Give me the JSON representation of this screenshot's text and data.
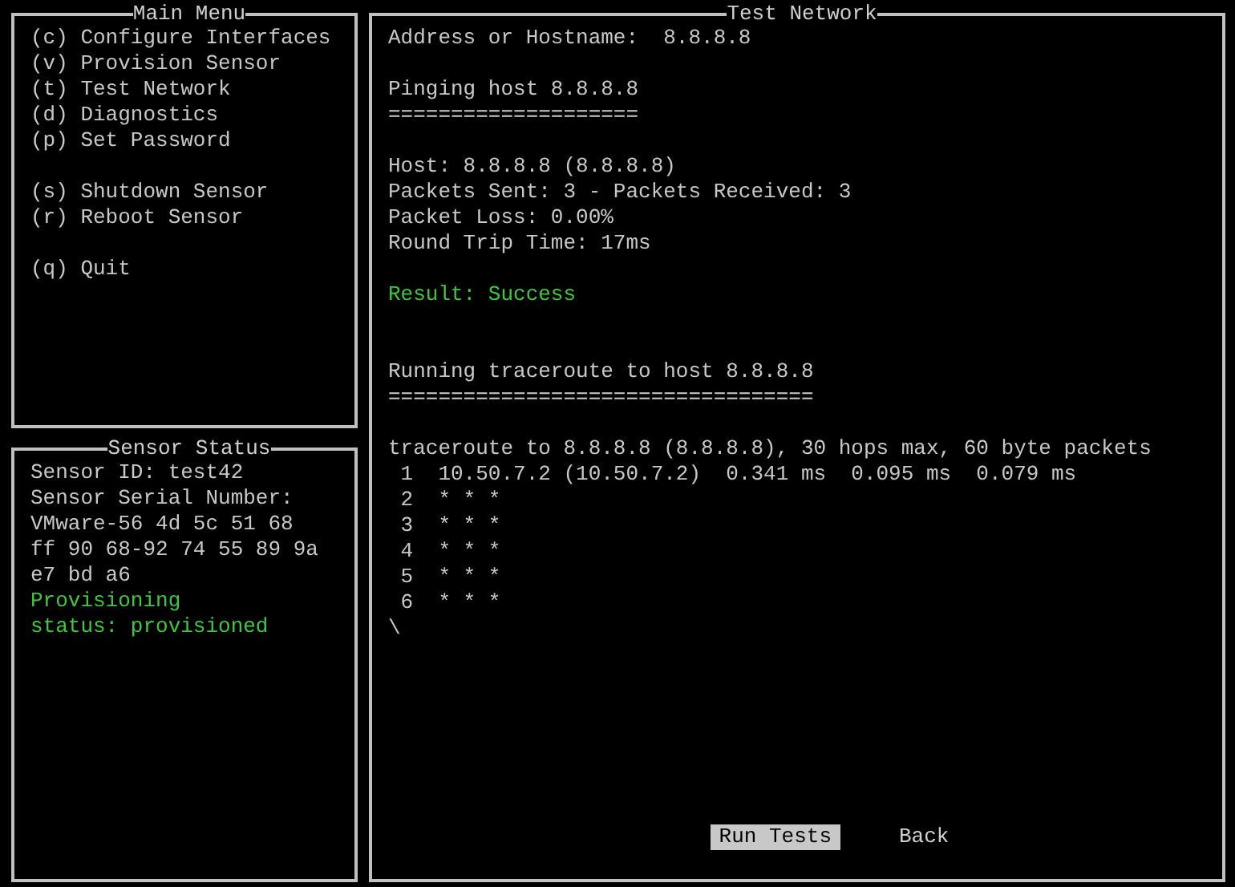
{
  "main_menu": {
    "title": "Main Menu",
    "items": [
      {
        "kind": "entry",
        "text": "(c) Configure Interfaces"
      },
      {
        "kind": "entry",
        "text": "(v) Provision Sensor"
      },
      {
        "kind": "entry",
        "text": "(t) Test Network"
      },
      {
        "kind": "entry",
        "text": "(d) Diagnostics"
      },
      {
        "kind": "entry",
        "text": "(p) Set Password"
      },
      {
        "kind": "gap"
      },
      {
        "kind": "entry",
        "text": "(s) Shutdown Sensor"
      },
      {
        "kind": "entry",
        "text": "(r) Reboot Sensor"
      },
      {
        "kind": "gap"
      },
      {
        "kind": "entry",
        "text": "(q) Quit"
      }
    ]
  },
  "sensor_status": {
    "title": "Sensor Status",
    "lines": [
      {
        "kind": "normal",
        "text": "Sensor ID: test42"
      },
      {
        "kind": "normal",
        "text": "Sensor Serial Number:"
      },
      {
        "kind": "normal",
        "text": "VMware-56 4d 5c 51 68"
      },
      {
        "kind": "normal",
        "text": "ff 90 68-92 74 55 89 9a"
      },
      {
        "kind": "normal",
        "text": "e7 bd a6"
      },
      {
        "kind": "success",
        "text": "Provisioning"
      },
      {
        "kind": "success",
        "text": "status: provisioned"
      }
    ]
  },
  "test_network": {
    "title": "Test Network",
    "lines": [
      {
        "kind": "normal",
        "text": "Address or Hostname:  8.8.8.8"
      },
      {
        "kind": "gap"
      },
      {
        "kind": "normal",
        "text": "Pinging host 8.8.8.8"
      },
      {
        "kind": "normal",
        "text": "===================="
      },
      {
        "kind": "gap"
      },
      {
        "kind": "normal",
        "text": "Host: 8.8.8.8 (8.8.8.8)"
      },
      {
        "kind": "normal",
        "text": "Packets Sent: 3 - Packets Received: 3"
      },
      {
        "kind": "normal",
        "text": "Packet Loss: 0.00%"
      },
      {
        "kind": "normal",
        "text": "Round Trip Time: 17ms"
      },
      {
        "kind": "gap"
      },
      {
        "kind": "success",
        "text": "Result: Success"
      },
      {
        "kind": "gap"
      },
      {
        "kind": "gap"
      },
      {
        "kind": "normal",
        "text": "Running traceroute to host 8.8.8.8"
      },
      {
        "kind": "normal",
        "text": "=================================="
      },
      {
        "kind": "gap"
      },
      {
        "kind": "normal",
        "text": "traceroute to 8.8.8.8 (8.8.8.8), 30 hops max, 60 byte packets"
      },
      {
        "kind": "normal",
        "text": " 1  10.50.7.2 (10.50.7.2)  0.341 ms  0.095 ms  0.079 ms"
      },
      {
        "kind": "normal",
        "text": " 2  * * *"
      },
      {
        "kind": "normal",
        "text": " 3  * * *"
      },
      {
        "kind": "normal",
        "text": " 4  * * *"
      },
      {
        "kind": "normal",
        "text": " 5  * * *"
      },
      {
        "kind": "normal",
        "text": " 6  * * *"
      },
      {
        "kind": "normal",
        "text": "\\"
      }
    ],
    "buttons": [
      {
        "label": "Run Tests",
        "selected": true
      },
      {
        "label": "Back",
        "selected": false
      }
    ]
  }
}
